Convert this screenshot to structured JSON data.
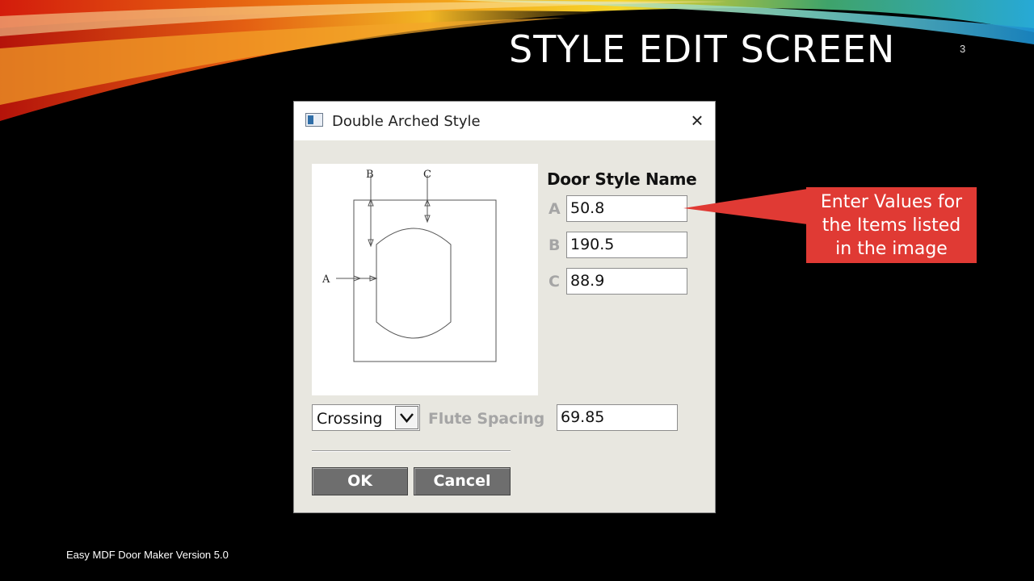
{
  "slide": {
    "title": "STYLE EDIT SCREEN",
    "number": "3",
    "footer": "Easy MDF Door Maker Version 5.0"
  },
  "dialog": {
    "title": "Double Arched Style",
    "style_name": "Door Style Name",
    "diagram_labels": {
      "a": "A",
      "b": "B",
      "c": "C"
    },
    "fields": [
      {
        "label": "A",
        "value": "50.8"
      },
      {
        "label": "B",
        "value": "190.5"
      },
      {
        "label": "C",
        "value": "88.9"
      }
    ],
    "pattern_select": {
      "selected": "Crossing"
    },
    "flute_spacing": {
      "label": "Flute Spacing",
      "value": "69.85"
    },
    "ok_label": "OK",
    "cancel_label": "Cancel"
  },
  "callout": {
    "lines": [
      "Enter Values for",
      "the Items listed",
      "in the image"
    ]
  },
  "colors": {
    "callout": "#e03a34",
    "dialog_bg": "#e8e7e0",
    "button": "#6e6e6e"
  },
  "icons": [
    "app-icon",
    "close-icon",
    "chevron-down-icon"
  ]
}
